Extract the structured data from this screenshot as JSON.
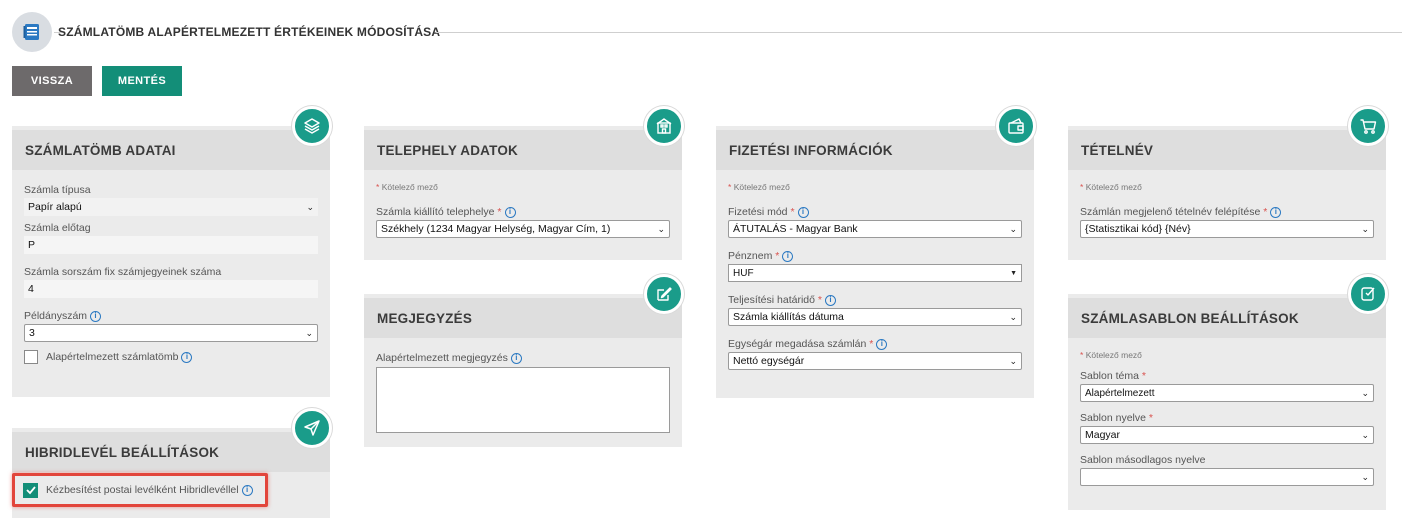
{
  "header": {
    "title": "Számlatömb alapértelmezett értékeinek módosítása"
  },
  "toolbar": {
    "back_label": "VISSZA",
    "save_label": "MENTÉS"
  },
  "colors": {
    "accent": "#1a9c8a",
    "save": "#138e78",
    "back": "#6d6a6b",
    "highlight": "#e2453b"
  },
  "required_note": "Kötelező mező",
  "required_mark": "*",
  "cards": {
    "szamlatomb": {
      "title": "Számlatömb adatai",
      "icon": "layers-icon",
      "tipus_label": "Számla típusa",
      "tipus_value": "Papír alapú",
      "elotag_label": "Számla előtag",
      "elotag_value": "P",
      "sorszam_label": "Számla sorszám fix számjegyeinek száma",
      "sorszam_value": "4",
      "peldany_label": "Példányszám",
      "peldany_value": "3",
      "alapert_label": "Alapértelmezett számlatömb"
    },
    "hibrid": {
      "title": "Hibridlevél beállítások",
      "icon": "send-icon",
      "kezbesites_label": "Kézbesítést postai levélként Hibridlevéllel"
    },
    "telephely": {
      "title": "Telephely adatok",
      "icon": "building-icon",
      "kiallito_label": "Számla kiállító telephelye",
      "kiallito_value": "Székhely (1234 Magyar Helység, Magyar Cím, 1)"
    },
    "megjegyzes": {
      "title": "Megjegyzés",
      "icon": "edit-icon",
      "alapert_label": "Alapértelmezett megjegyzés"
    },
    "fizetes": {
      "title": "Fizetési információk",
      "icon": "wallet-icon",
      "mod_label": "Fizetési mód",
      "mod_value": "ÁTUTALÁS - Magyar Bank",
      "penznem_label": "Pénznem",
      "penznem_value": "HUF",
      "hatarido_label": "Teljesítési határidő",
      "hatarido_value": "Számla kiállítás dátuma",
      "egysegar_label": "Egységár megadása számlán",
      "egysegar_value": "Nettó egységár"
    },
    "tetelnev": {
      "title": "Tételnév",
      "icon": "cart-icon",
      "felepites_label": "Számlán megjelenő tételnév felépítése",
      "felepites_value": "{Statisztikai kód} {Név}"
    },
    "sablon": {
      "title": "Számlasablon beállítások",
      "icon": "template-icon",
      "tema_label": "Sablon téma",
      "tema_value": "Alapértelmezett",
      "nyelv_label": "Sablon nyelve",
      "nyelv_value": "Magyar",
      "masodlagos_label": "Sablon másodlagos nyelve",
      "masodlagos_value": ""
    }
  }
}
